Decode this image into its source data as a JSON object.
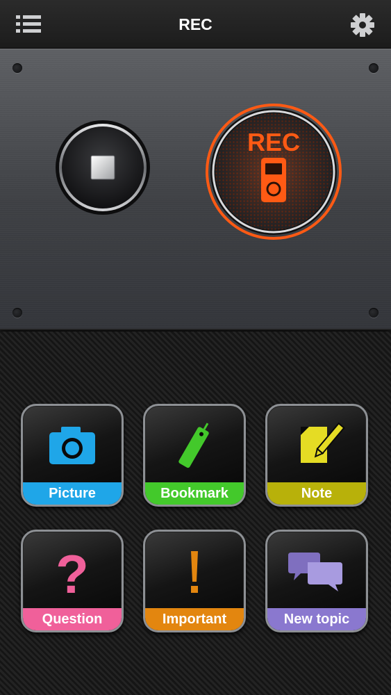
{
  "header": {
    "title": "REC"
  },
  "recorder": {
    "rec_label": "REC"
  },
  "tiles": [
    {
      "label": "Picture",
      "color": "#1fa6e8"
    },
    {
      "label": "Bookmark",
      "color": "#43c92b"
    },
    {
      "label": "Note",
      "color": "#b8b10a"
    },
    {
      "label": "Question",
      "color": "#f0609a"
    },
    {
      "label": "Important",
      "color": "#e3860f"
    },
    {
      "label": "New topic",
      "color": "#8a78cf"
    }
  ],
  "colors": {
    "accent": "#ff5a14",
    "background": "#1a1a1a"
  }
}
